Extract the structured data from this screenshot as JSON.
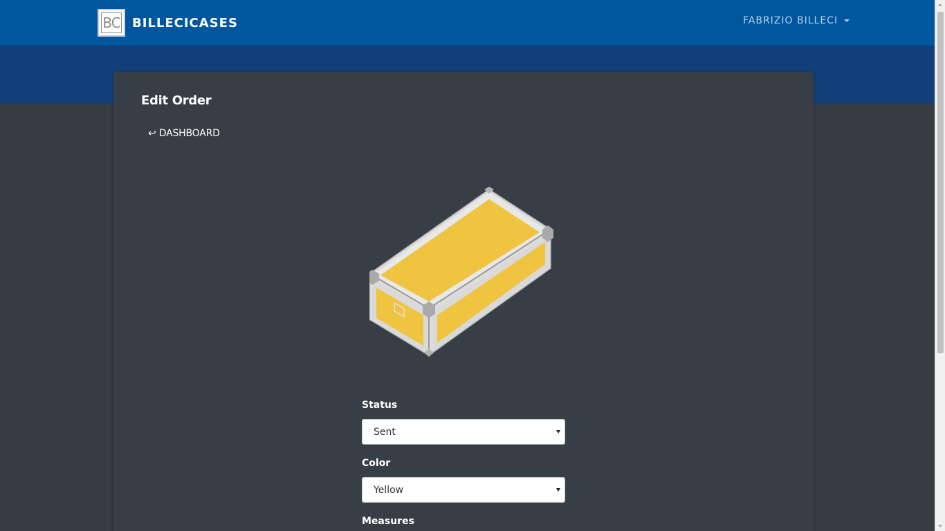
{
  "navbar": {
    "logo_text": "BC",
    "brand_name": "BILLECICASES",
    "user_name": "FABRIZIO BILLECI"
  },
  "page": {
    "title": "Edit Order",
    "back_link": "↩ DASHBOARD"
  },
  "case_preview": {
    "color": "#f4c51c",
    "frame_color": "#e6e6e6"
  },
  "form": {
    "status": {
      "label": "Status",
      "value": "Sent"
    },
    "color": {
      "label": "Color",
      "value": "Yellow"
    },
    "measures": {
      "label": "Measures"
    }
  },
  "colors": {
    "navbar": "#01579f",
    "hero": "#123f79",
    "background": "#363c44",
    "card": "#383e46"
  }
}
